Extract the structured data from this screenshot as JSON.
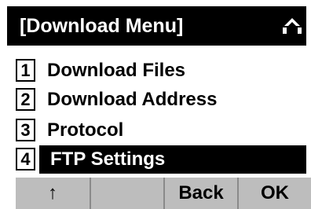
{
  "title": "[Download Menu]",
  "title_icon": "up-down-scroll-icon",
  "menu": {
    "items": [
      {
        "number": "1",
        "label": "Download Files",
        "selected": false
      },
      {
        "number": "2",
        "label": "Download Address",
        "selected": false
      },
      {
        "number": "3",
        "label": "Protocol",
        "selected": false
      },
      {
        "number": "4",
        "label": "FTP Settings",
        "selected": true
      }
    ]
  },
  "softkeys": {
    "key1": "↑",
    "key2": "",
    "key3": "Back",
    "key4": "OK"
  },
  "colors": {
    "titlebar_bg": "#000000",
    "selected_bg": "#000000",
    "softkey_bg": "#bdbdbd"
  }
}
